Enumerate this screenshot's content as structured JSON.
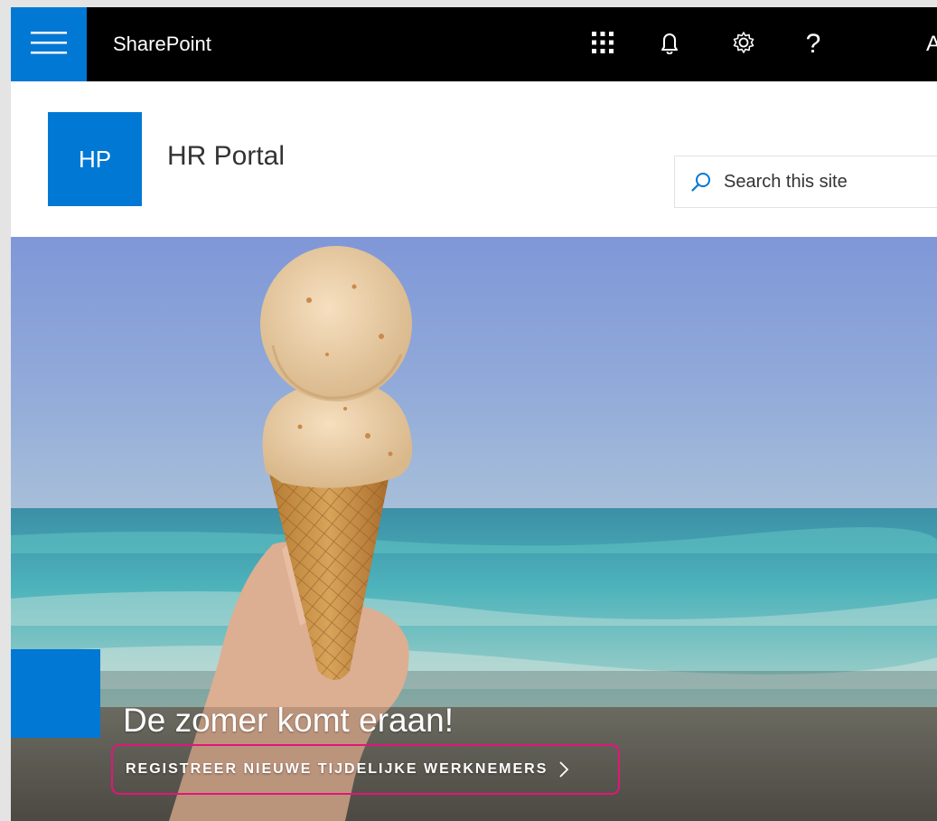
{
  "suitebar": {
    "brand": "SharePoint",
    "user_initial": "A",
    "icons": [
      "hamburger-icon",
      "app-launcher-icon",
      "bell-icon",
      "gear-icon",
      "help-icon"
    ],
    "help_glyph": "?"
  },
  "site": {
    "logo_initials": "HP",
    "title": "HR Portal"
  },
  "search": {
    "placeholder": "Search this site"
  },
  "hero": {
    "title": "De zomer komt eraan!",
    "link_label": "REGISTREER NIEUWE TIJDELIJKE WERKNEMERS"
  },
  "colors": {
    "accent": "#0078d4",
    "suitebar": "#000000",
    "focus_outline": "#e3157a"
  }
}
